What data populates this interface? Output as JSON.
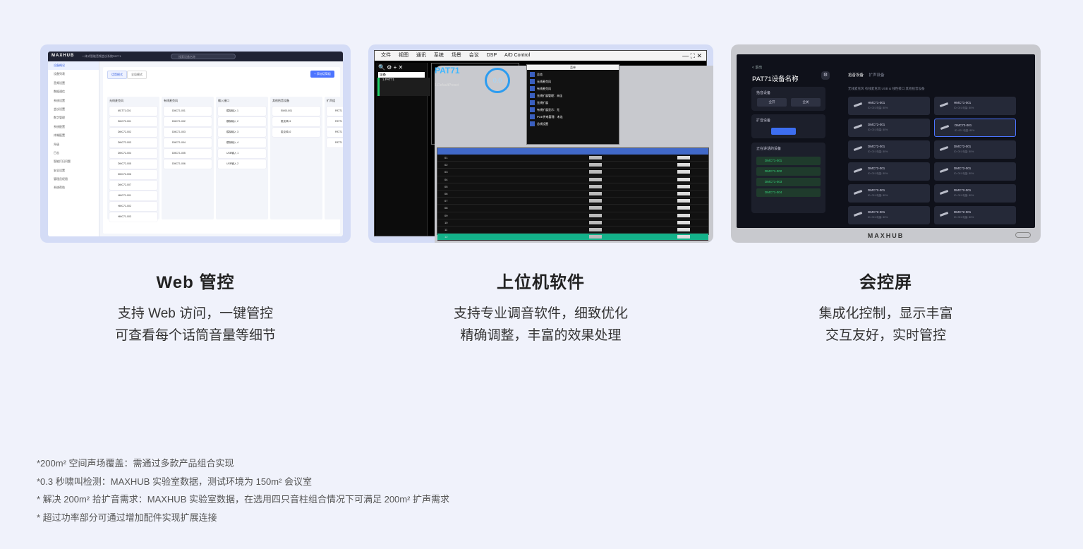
{
  "web_ui": {
    "logo": "MAXHUB",
    "subtitle": "一体式智能音频会议系统PAT71",
    "search_placeholder": "搜索设备名称",
    "sidebar": [
      "设备概况",
      "设备列表",
      "音频设置",
      "数据通信",
      "系统设置",
      "会议设置",
      "数字管理",
      "系统配置",
      "终端配置",
      "升级",
      "日志",
      "智能打扫问题",
      "安全设置",
      "管理员权限",
      "系统帮助"
    ],
    "tabs": [
      "话筒模式",
      "全局模式"
    ],
    "add_button": "+ 添加话筒组",
    "columns": [
      {
        "title": "无线麦克风",
        "items": [
          "MCT71-001",
          "DMC72-001",
          "DMC72-002",
          "DMC72-003",
          "DMC72-004",
          "DMC72-005",
          "DMC72-006",
          "DMC72-007",
          "HMC71-001",
          "HMC71-002",
          "HMC71-003"
        ]
      },
      {
        "title": "有线麦克风",
        "items": [
          "DMC71-001",
          "DMC71-002",
          "DMC71-003",
          "DMC71-004",
          "DMC71-005",
          "DMC71-006"
        ]
      },
      {
        "title": "输入接口",
        "items": [
          "模拟输入 1",
          "模拟输入 2",
          "模拟输入 3",
          "模拟输入 4",
          "USB输入 1",
          "USB输入 2"
        ]
      },
      {
        "title": "其他拾音设备",
        "items": [
          "EM00-001",
          "麦克风01",
          "麦克风02"
        ]
      },
      {
        "title": "扩声组",
        "items": [
          "PAT71",
          "PAT71",
          "PAT71",
          "PAT71"
        ]
      }
    ]
  },
  "pc_ui": {
    "menu": [
      "文件",
      "视图",
      "通讯",
      "系统",
      "场景",
      "会议",
      "DSP",
      "A/D Control"
    ],
    "device_list_title": "设备",
    "device_selected": "1.PAT71",
    "device_name": "PAT71",
    "preset": "1.DefaultPreset",
    "meter_value": "0.0",
    "popup_title": "菜单",
    "popup_items": [
      "总览",
      "无线麦克风",
      "有线麦克风",
      "无线扩展管理：未连",
      "无线扩展",
      "有线扩展显示：无",
      "POE供电管理：未连",
      "总线设置"
    ],
    "table_rows": [
      "01",
      "02",
      "03",
      "04",
      "05",
      "06",
      "07",
      "08",
      "09",
      "10",
      "11",
      "12"
    ]
  },
  "tablet_ui": {
    "back": "< 退出",
    "title": "PAT71设备名称",
    "panels": [
      "拾音设备",
      "扩音设备",
      "正在讲话的设备"
    ],
    "pickup_buttons": [
      "全开",
      "全关"
    ],
    "speaking": [
      "DMC71-001",
      "DMC71-002",
      "DMC71-003",
      "DMC71-004"
    ],
    "tabs": [
      "拾音设备",
      "扩声设备"
    ],
    "subtabs": "无线麦克风    有线麦克风    USB & 线性接口    其他拾音设备",
    "devices": [
      "HMC71-001",
      "HMC71-001",
      "DMC72-001",
      "DMC72-001",
      "DMC72-001",
      "DMC72-001",
      "DMC72-001",
      "DMC72-001",
      "DMC72-001",
      "DMC72-001",
      "DMC72-001",
      "DMC72-001"
    ],
    "device_sub": "ID: 001  电量: 80%",
    "brand": "MAXHUB"
  },
  "captions": [
    {
      "title": "Web 管控",
      "line1": "支持 Web 访问，一键管控",
      "line2": "可查看每个话筒音量等细节"
    },
    {
      "title": "上位机软件",
      "line1": "支持专业调音软件，细致优化",
      "line2": "精确调整，丰富的效果处理"
    },
    {
      "title": "会控屏",
      "line1": "集成化控制，显示丰富",
      "line2": "交互友好，实时管控"
    }
  ],
  "notes": [
    "*200m² 空间声场覆盖：需通过多款产品组合实现",
    "*0.3 秒啸叫检测：MAXHUB 实验室数据，测试环境为 150m² 会议室",
    "* 解决 200m² 拾扩音需求：MAXHUB 实验室数据，在选用四只音柱组合情况下可满足 200m² 扩声需求",
    "* 超过功率部分可通过增加配件实现扩展连接"
  ],
  "colors": {
    "accent": "#4c74ff",
    "green": "#1fd26a",
    "pc_blue": "#4169c9"
  }
}
